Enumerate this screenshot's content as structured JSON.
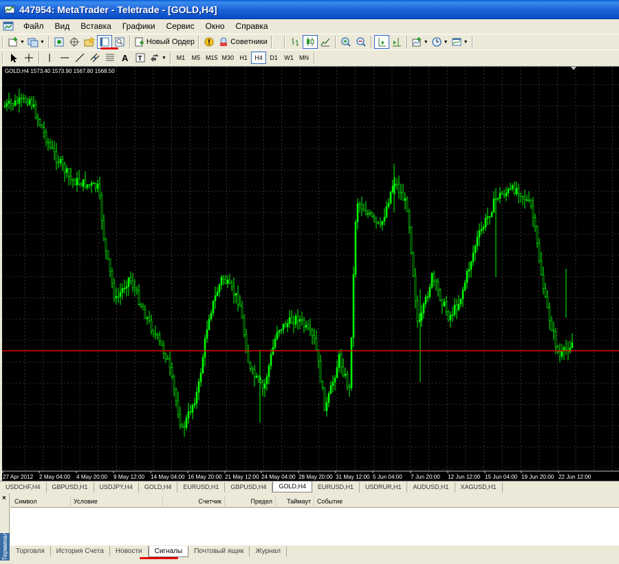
{
  "window": {
    "title": "447954: MetaTrader - Teletrade - [GOLD,H4]"
  },
  "menu": [
    "Файл",
    "Вид",
    "Вставка",
    "Графики",
    "Сервис",
    "Окно",
    "Справка"
  ],
  "toolbar": {
    "new_order_label": "Новый Ордер",
    "experts_label": "Советники"
  },
  "timeframes": [
    "M1",
    "M5",
    "M15",
    "M30",
    "H1",
    "H4",
    "D1",
    "W1",
    "MN"
  ],
  "active_timeframe": "H4",
  "chart": {
    "header": "GOLD,H4  1573.40 1573.90 1567.80 1568.50",
    "candle_color": "#00ff00",
    "background": "#000000",
    "price_line_color": "#e00000",
    "time_labels": [
      "27 Apr 2012",
      "2 May 04:00",
      "4 May 20:00",
      "9 May 12:00",
      "14 May 04:00",
      "16 May 20:00",
      "21 May 12:00",
      "24 May 04:00",
      "28 May 20:00",
      "31 May 12:00",
      "5 Jun 04:00",
      "7 Jun 20:00",
      "12 Jun 12:00",
      "15 Jun 04:00",
      "19 Jun 20:00",
      "22 Jun 12:00"
    ]
  },
  "chart_tabs": [
    "USDCHF,H4",
    "GBPUSD,H1",
    "USDJPY,H4",
    "GOLD,H4",
    "EURUSD,H1",
    "GBPUSD,H4",
    "GOLD,H4",
    "EURUSD,H1",
    "USDRUR,H1",
    "AUDUSD,H1",
    "XAGUSD,H1"
  ],
  "active_chart_tab": 6,
  "terminal": {
    "side_label": "Терминал",
    "columns": [
      "Символ",
      "Условие",
      "Счетчик",
      "Предел",
      "Таймаут",
      "Событие"
    ],
    "tabs": [
      "Торговля",
      "История Счета",
      "Новости",
      "Сигналы",
      "Почтовый ящик",
      "Журнал"
    ],
    "active_tab": 3
  }
}
